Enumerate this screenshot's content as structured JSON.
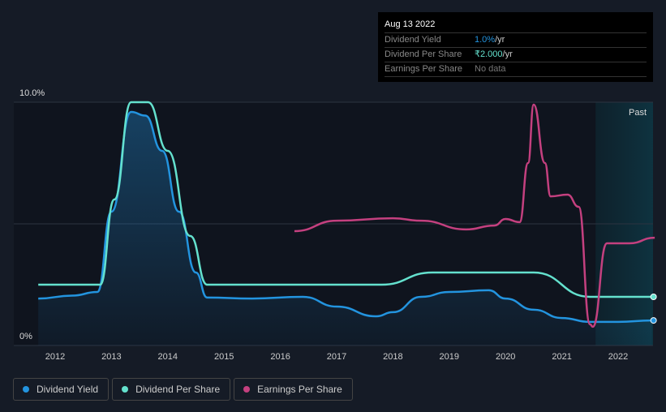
{
  "tooltip": {
    "date": "Aug 13 2022",
    "rows": [
      {
        "label": "Dividend Yield",
        "value": "1.0%",
        "unit": " /yr",
        "color": "#2394df"
      },
      {
        "label": "Dividend Per Share",
        "value": "₹2.000",
        "unit": " /yr",
        "color": "#64e1ce"
      },
      {
        "label": "Earnings Per Share",
        "value": "No data",
        "unit": "",
        "color": "#777777"
      }
    ]
  },
  "chart_data": {
    "type": "line",
    "past_label": "Past",
    "past_start": 2021.6,
    "ylim": [
      0,
      10
    ],
    "y_ticks": [
      "0%",
      "10.0%"
    ],
    "x_ticks": [
      "2012",
      "2013",
      "2014",
      "2015",
      "2016",
      "2017",
      "2018",
      "2019",
      "2020",
      "2021",
      "2022"
    ],
    "xlim": [
      2011.3,
      2022.6
    ],
    "series": [
      {
        "name": "Dividend Yield",
        "color": "#2394df",
        "area": true,
        "points": [
          [
            2011.7,
            1.93
          ],
          [
            2012.3,
            2.05
          ],
          [
            2012.75,
            2.2
          ],
          [
            2013.0,
            5.5
          ],
          [
            2013.35,
            9.6
          ],
          [
            2013.6,
            9.45
          ],
          [
            2013.9,
            8
          ],
          [
            2014.2,
            5.5
          ],
          [
            2014.5,
            3
          ],
          [
            2014.7,
            1.97
          ],
          [
            2015.5,
            1.93
          ],
          [
            2016.4,
            2.0
          ],
          [
            2017,
            1.6
          ],
          [
            2017.7,
            1.2
          ],
          [
            2018,
            1.37
          ],
          [
            2018.5,
            2.0
          ],
          [
            2019,
            2.2
          ],
          [
            2019.7,
            2.27
          ],
          [
            2020,
            1.93
          ],
          [
            2020.5,
            1.47
          ],
          [
            2021,
            1.13
          ],
          [
            2021.5,
            0.97
          ],
          [
            2022,
            0.97
          ],
          [
            2022.6,
            1.03
          ]
        ]
      },
      {
        "name": "Dividend Per Share",
        "color": "#64e1ce",
        "points": [
          [
            2011.7,
            2.5
          ],
          [
            2012.8,
            2.5
          ],
          [
            2013.05,
            6
          ],
          [
            2013.35,
            10
          ],
          [
            2013.65,
            10
          ],
          [
            2014.0,
            8
          ],
          [
            2014.4,
            4.5
          ],
          [
            2014.7,
            2.5
          ],
          [
            2017.8,
            2.5
          ],
          [
            2018.7,
            3.0
          ],
          [
            2020.5,
            3.0
          ],
          [
            2021.5,
            2.0
          ],
          [
            2022.6,
            2.0
          ]
        ]
      },
      {
        "name": "Earnings Per Share",
        "color": "#c4407f",
        "points": [
          [
            2016.25,
            4.7
          ],
          [
            2017,
            5.13
          ],
          [
            2018,
            5.23
          ],
          [
            2018.5,
            5.13
          ],
          [
            2019.3,
            4.77
          ],
          [
            2019.8,
            4.93
          ],
          [
            2020,
            5.2
          ],
          [
            2020.25,
            5.07
          ],
          [
            2020.4,
            7.5
          ],
          [
            2020.5,
            9.9
          ],
          [
            2020.7,
            7.5
          ],
          [
            2020.8,
            6.13
          ],
          [
            2021.1,
            6.2
          ],
          [
            2021.3,
            5.7
          ],
          [
            2021.5,
            0.87
          ],
          [
            2021.55,
            0.77
          ],
          [
            2021.8,
            4.2
          ],
          [
            2022.2,
            4.2
          ],
          [
            2022.65,
            4.43
          ]
        ]
      }
    ]
  },
  "legend": [
    {
      "label": "Dividend Yield",
      "color": "#2394df"
    },
    {
      "label": "Dividend Per Share",
      "color": "#64e1ce"
    },
    {
      "label": "Earnings Per Share",
      "color": "#c4407f"
    }
  ]
}
